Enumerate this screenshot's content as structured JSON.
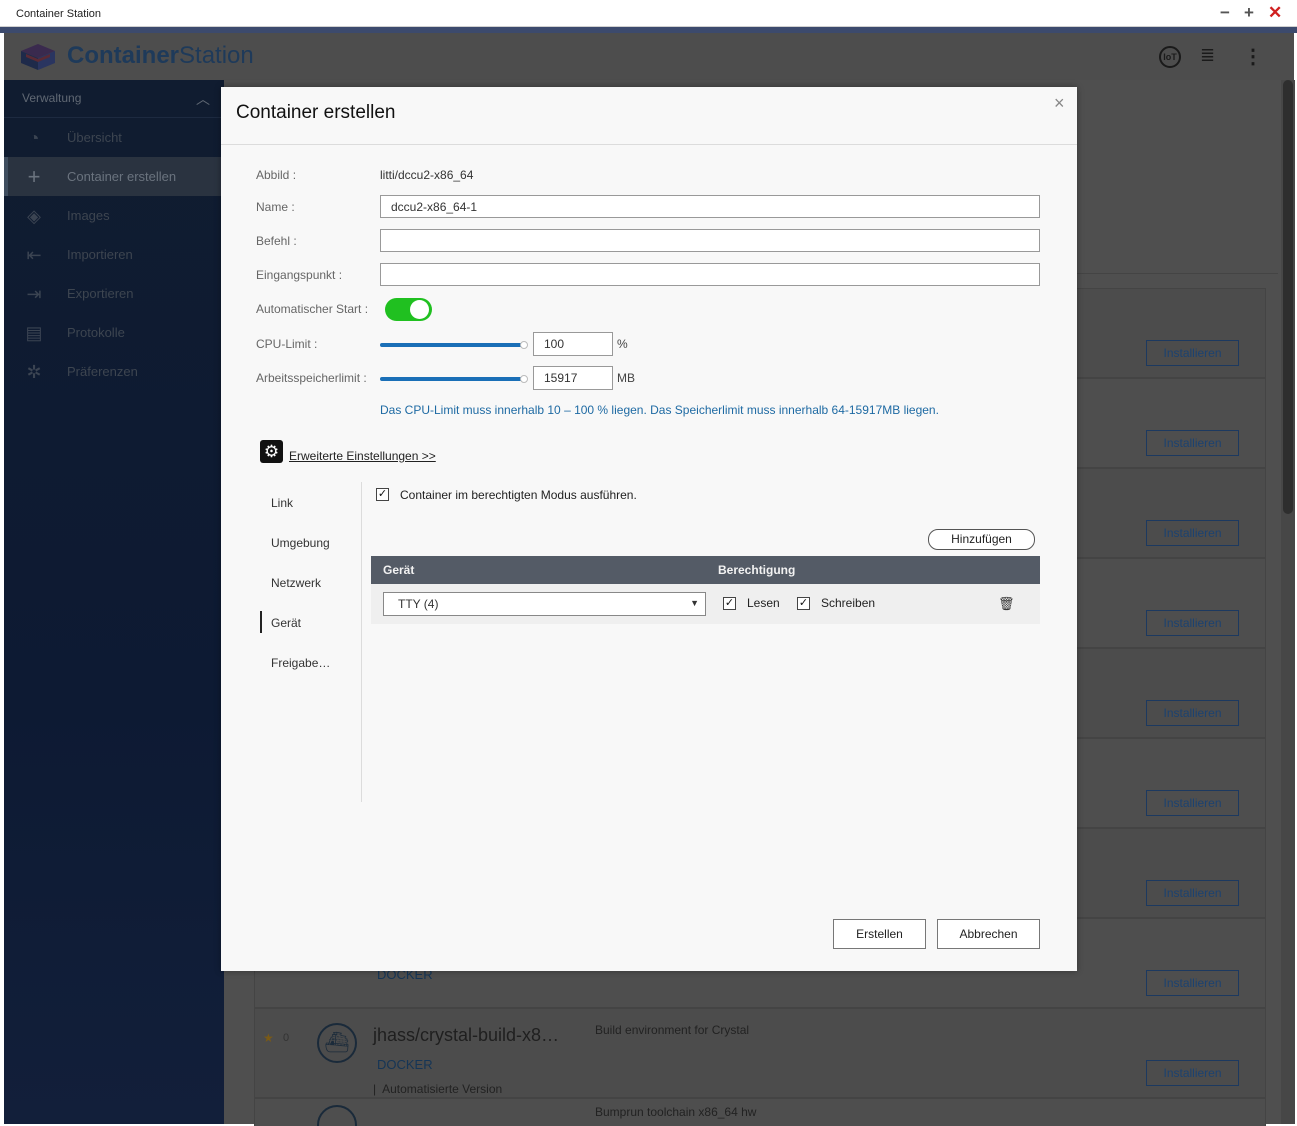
{
  "window": {
    "title": "Container Station",
    "controls": {
      "minimize": "−",
      "maximize": "+",
      "close": "✕"
    }
  },
  "header": {
    "brand_bold": "Container",
    "brand_light": "Station",
    "icons": {
      "iot": "IoT",
      "stack": "≣",
      "more": "⋮"
    }
  },
  "sidebar": {
    "section_label": "Verwaltung",
    "items": [
      {
        "label": "Übersicht",
        "icon": "gauge-icon",
        "glyph": "◔"
      },
      {
        "label": "Container erstellen",
        "icon": "plus-icon",
        "glyph": "+"
      },
      {
        "label": "Images",
        "icon": "layers-icon",
        "glyph": "◈"
      },
      {
        "label": "Importieren",
        "icon": "import-icon",
        "glyph": "⇤"
      },
      {
        "label": "Exportieren",
        "icon": "export-icon",
        "glyph": "⇥"
      },
      {
        "label": "Protokolle",
        "icon": "document-icon",
        "glyph": "▤"
      },
      {
        "label": "Präferenzen",
        "icon": "gear-icon",
        "glyph": "✲"
      }
    ],
    "handle_glyph": "≡"
  },
  "background_list": {
    "install_label": "Installieren",
    "rows": [
      {
        "source": "DOCKER"
      },
      {
        "stars": "0",
        "name": "jhass/crystal-build-x8…",
        "description": "Build environment for Crystal",
        "source": "DOCKER",
        "auto_label": "Automatisierte Version"
      },
      {
        "description": "Bumprun toolchain x86_64 hw"
      }
    ]
  },
  "dialog": {
    "title": "Container erstellen",
    "close_glyph": "×",
    "fields": {
      "image_label": "Abbild :",
      "image_value": "litti/dccu2-x86_64",
      "name_label": "Name :",
      "name_value": "dccu2-x86_64-1",
      "command_label": "Befehl :",
      "command_value": "",
      "entrypoint_label": "Eingangspunkt :",
      "entrypoint_value": "",
      "autostart_label": "Automatischer Start :",
      "autostart_on": true,
      "cpu_label": "CPU-Limit :",
      "cpu_value": "100",
      "cpu_unit": "%",
      "memory_label": "Arbeitsspeicherlimit :",
      "memory_value": "15917",
      "memory_unit": "MB",
      "hint": "Das CPU-Limit muss innerhalb 10 – 100 % liegen. Das Speicherlimit muss innerhalb 64-15917MB liegen."
    },
    "advanced_link": "Erweiterte Einstellungen >>",
    "tabs": [
      {
        "label": "Link",
        "active": false
      },
      {
        "label": "Umgebung",
        "active": false
      },
      {
        "label": "Netzwerk",
        "active": false
      },
      {
        "label": "Gerät",
        "active": true
      },
      {
        "label": "Freigabe…",
        "active": false
      }
    ],
    "device_panel": {
      "privileged_label": "Container im berechtigten Modus ausführen.",
      "privileged_checked": true,
      "add_button": "Hinzufügen",
      "columns": [
        "Gerät",
        "Berechtigung"
      ],
      "rows": [
        {
          "device": "TTY (4)",
          "read_label": "Lesen",
          "read_checked": true,
          "write_label": "Schreiben",
          "write_checked": true
        }
      ]
    },
    "buttons": {
      "create": "Erstellen",
      "cancel": "Abbrechen"
    }
  },
  "colors": {
    "accent_blue": "#1a6fb7",
    "toggle_on": "#20c020",
    "table_header": "#545b66",
    "hint_text": "#1e6aa3"
  }
}
